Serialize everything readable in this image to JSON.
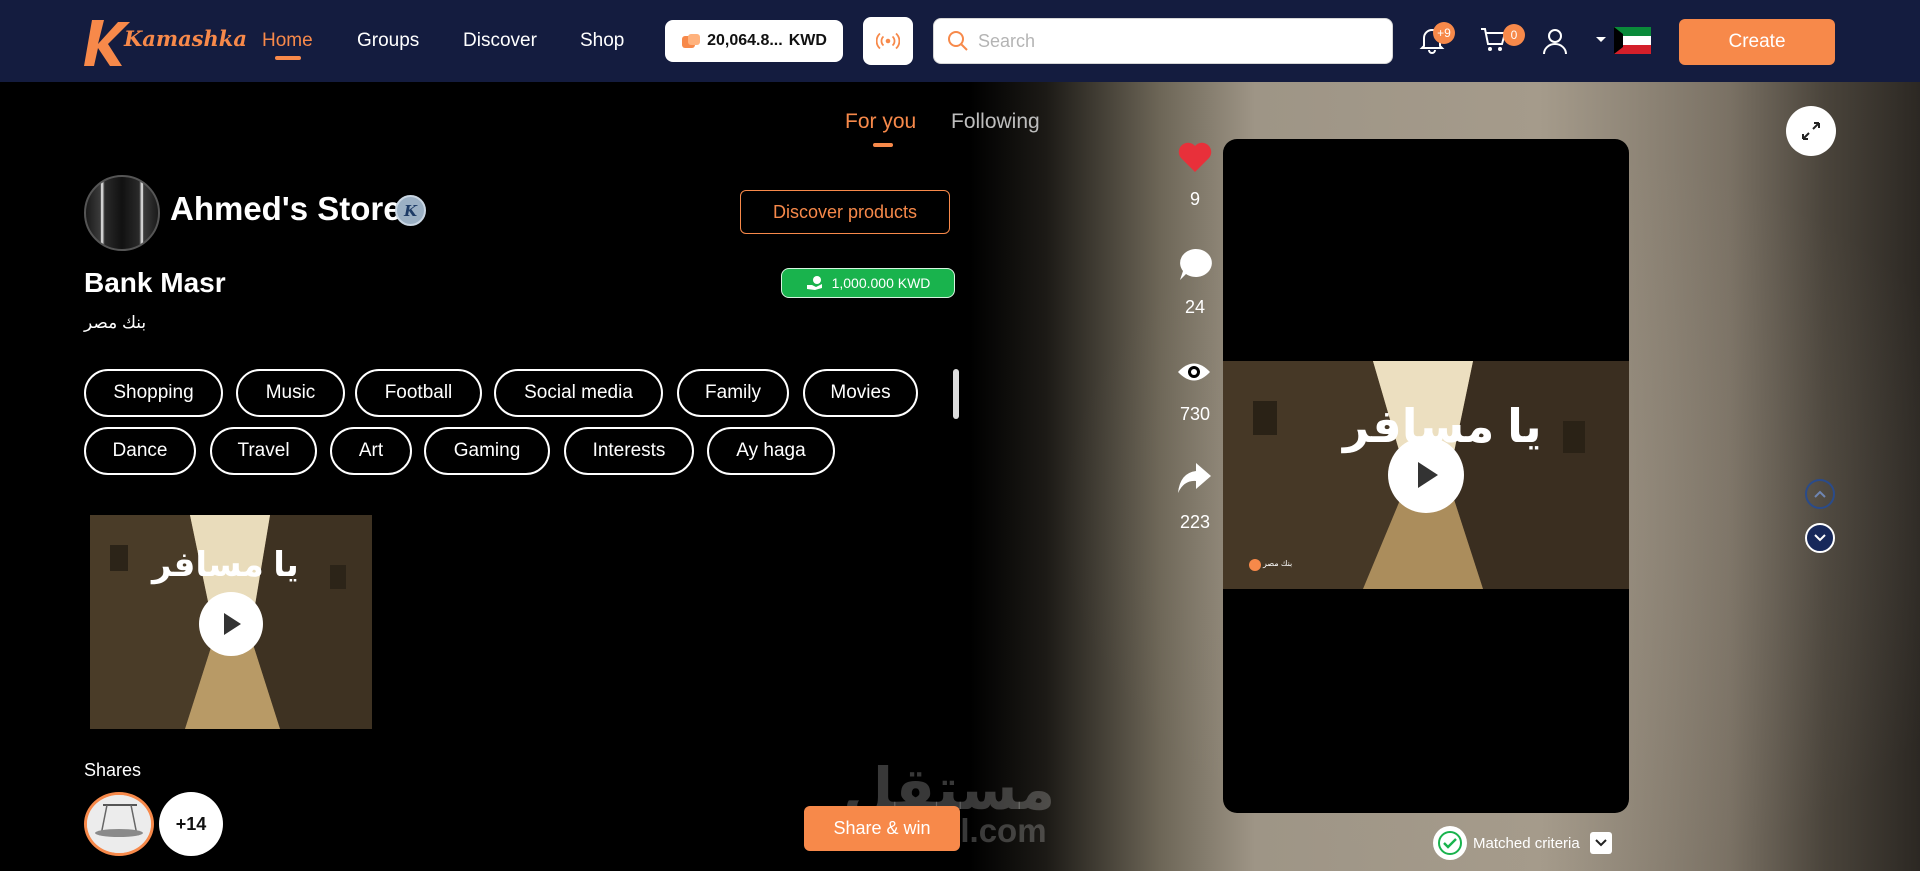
{
  "brand": {
    "logo_text": "Kamashka",
    "accent": "#f7894a",
    "nav_bg": "#141c3f"
  },
  "nav": {
    "links": [
      "Home",
      "Groups",
      "Discover",
      "Shop"
    ],
    "active": "Home"
  },
  "wallet": {
    "balance": "20,064.8...",
    "currency": "KWD",
    "icon": "coins-icon"
  },
  "live_icon": "broadcast-icon",
  "search": {
    "placeholder": "Search",
    "value": ""
  },
  "notifications": {
    "icon": "bell-icon",
    "badge": "+9"
  },
  "cart": {
    "icon": "cart-icon",
    "badge": "0"
  },
  "profile_icon": "user-icon",
  "country": {
    "flag": "kuwait-flag-icon"
  },
  "create_label": "Create",
  "feed_tabs": [
    "For you",
    "Following"
  ],
  "active_feed_tab": "For you",
  "post": {
    "store_name": "Ahmed's Store",
    "verified_badge": "K",
    "discover_button": "Discover products",
    "bank_name": "Bank Masr",
    "bank_name_ar": "بنك مصر",
    "reward": "1,000.000 KWD",
    "interests": [
      "Shopping",
      "Music",
      "Football",
      "Social media",
      "Family",
      "Movies",
      "Dance",
      "Travel",
      "Art",
      "Gaming",
      "Interests",
      "Ay haga"
    ],
    "video_title_ar": "يا مسافر",
    "video_brand": "بنك مصر",
    "shares_label": "Shares",
    "more_shares": "+14"
  },
  "stats": {
    "likes": "9",
    "comments": "24",
    "views": "730",
    "shares": "223"
  },
  "share_win_label": "Share & win",
  "matched_criteria": "Matched criteria",
  "watermark": {
    "arabic": "مستقل",
    "latin": "mostaql.com"
  }
}
